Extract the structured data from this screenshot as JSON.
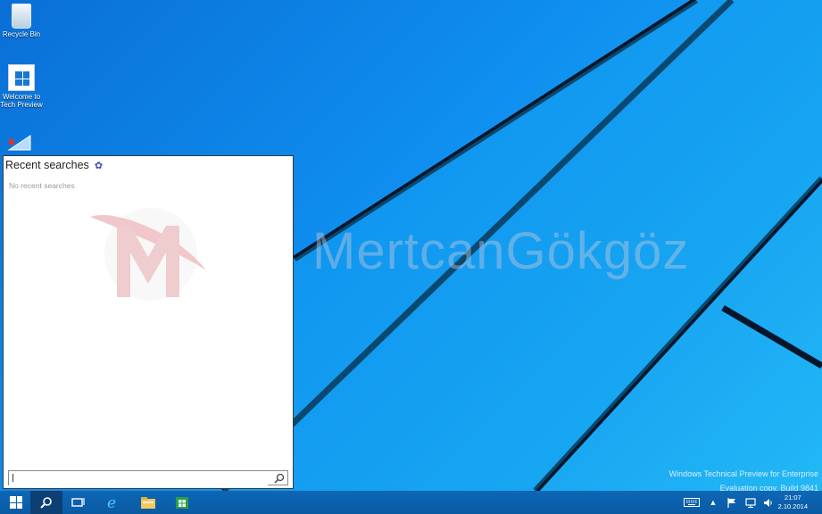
{
  "desktop": {
    "icons": [
      {
        "name": "Recycle Bin",
        "label": "Recycle Bin"
      },
      {
        "name": "Welcome to Tech Preview",
        "label_line1": "Welcome to",
        "label_line2": "Tech Preview"
      }
    ]
  },
  "search_panel": {
    "title": "Recent searches",
    "empty_text": "No recent searches",
    "input_value": "",
    "input_placeholder": ""
  },
  "watermark": {
    "text": "MertcanGökgöz"
  },
  "build_info": {
    "line1": "Windows Technical Preview for Enterprise",
    "line2": "Evaluation copy. Build 9841"
  },
  "taskbar": {
    "clock_time": "21:07",
    "clock_date": "2.10.2014",
    "icons": [
      "start-icon",
      "search-icon",
      "task-view-icon",
      "internet-explorer-icon",
      "file-explorer-icon",
      "store-icon"
    ],
    "tray_icons": [
      "keyboard-icon",
      "chevron-up-icon",
      "flag-icon",
      "network-icon",
      "volume-icon"
    ]
  },
  "colors": {
    "accent": "#1877d0",
    "taskbar": "#0a5aa3",
    "gear": "#3b4bb5"
  }
}
